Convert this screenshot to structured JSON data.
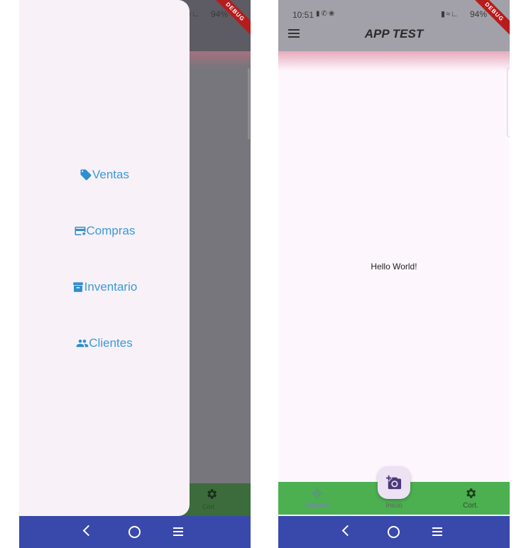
{
  "status_bar": {
    "time": "10:51",
    "left_icons": [
      "sim-icon",
      "whatsapp-icon",
      "game-icon"
    ],
    "right_icons": [
      "battery-saver-icon",
      "wifi-icon",
      "signal-icon"
    ],
    "battery": "94%"
  },
  "debug_banner": "DEBUG",
  "drawer": {
    "items": [
      {
        "label": "Ventas",
        "icon": "tag-icon"
      },
      {
        "label": "Compras",
        "icon": "card-plus-icon"
      },
      {
        "label": "Inventario",
        "icon": "archive-icon"
      },
      {
        "label": "Clientes",
        "icon": "people-icon"
      }
    ]
  },
  "app": {
    "title": "APP TEST",
    "body_text": "Hello World!"
  },
  "bottom_nav": {
    "items": [
      {
        "label": "Reporte",
        "icon": "graphic-eq-icon"
      },
      {
        "label": "Inicio",
        "icon": "add-camera-icon"
      },
      {
        "label": "Cort.",
        "icon": "settings-icon"
      }
    ],
    "partial_label": "Cort"
  },
  "colors": {
    "drawer_text": "#3c9ad6",
    "bottom_nav_bg": "#4caf50",
    "system_nav_bg": "#3949ab",
    "app_bar_bg": "#a2a1a9",
    "fab_bg": "#ece2f4",
    "fab_icon": "#4a3a7a"
  }
}
